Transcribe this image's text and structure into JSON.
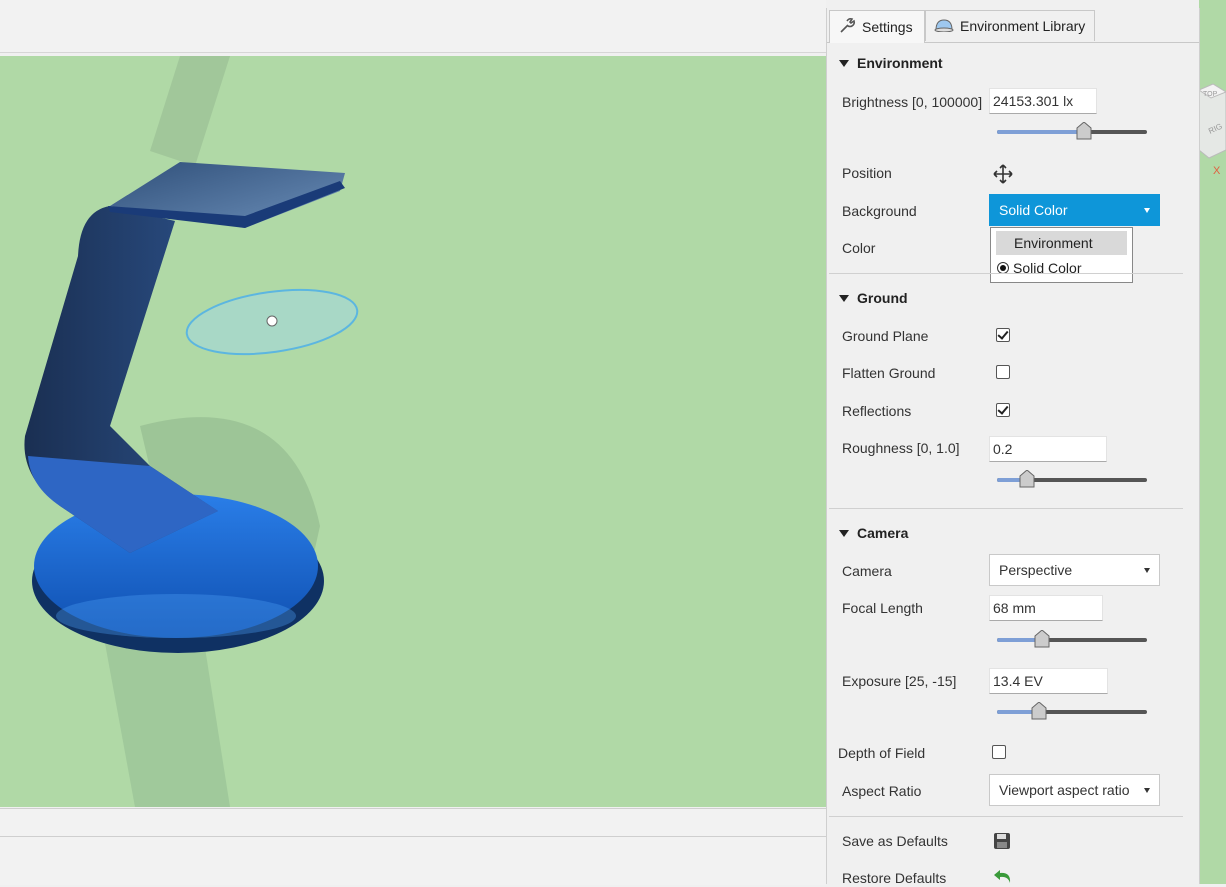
{
  "tabs": [
    {
      "label": "Settings",
      "icon": "wrench-icon"
    },
    {
      "label": "Environment Library",
      "icon": "dome-icon"
    }
  ],
  "environment": {
    "header": "Environment",
    "brightness_label": "Brightness [0, 100000]",
    "brightness_value": "24153.301 lx",
    "brightness_slider": 0.58,
    "position_label": "Position",
    "background_label": "Background",
    "background_value": "Solid Color",
    "color_label": "Color",
    "background_options": [
      "Environment",
      "Solid Color"
    ]
  },
  "ground": {
    "header": "Ground",
    "ground_plane_label": "Ground Plane",
    "ground_plane_checked": true,
    "flatten_label": "Flatten Ground",
    "flatten_checked": false,
    "reflections_label": "Reflections",
    "reflections_checked": true,
    "roughness_label": "Roughness [0, 1.0]",
    "roughness_value": "0.2",
    "roughness_slider": 0.2
  },
  "camera": {
    "header": "Camera",
    "camera_label": "Camera",
    "camera_value": "Perspective",
    "focal_label": "Focal Length",
    "focal_value": "68 mm",
    "focal_slider": 0.3,
    "exposure_label": "Exposure [25, -15]",
    "exposure_value": "13.4 EV",
    "exposure_slider": 0.28,
    "dof_label": "Depth of Field",
    "dof_checked": false,
    "aspect_label": "Aspect Ratio",
    "aspect_value": "Viewport aspect ratio"
  },
  "footer": {
    "save_label": "Save as Defaults",
    "restore_label": "Restore Defaults"
  },
  "viewcube": {
    "top": "TOP",
    "right": "RIG",
    "axis": "X"
  },
  "colors": {
    "viewport": "#b0d9a6",
    "accent": "#0e96d9",
    "slider_fill": "#7e9fd6"
  }
}
